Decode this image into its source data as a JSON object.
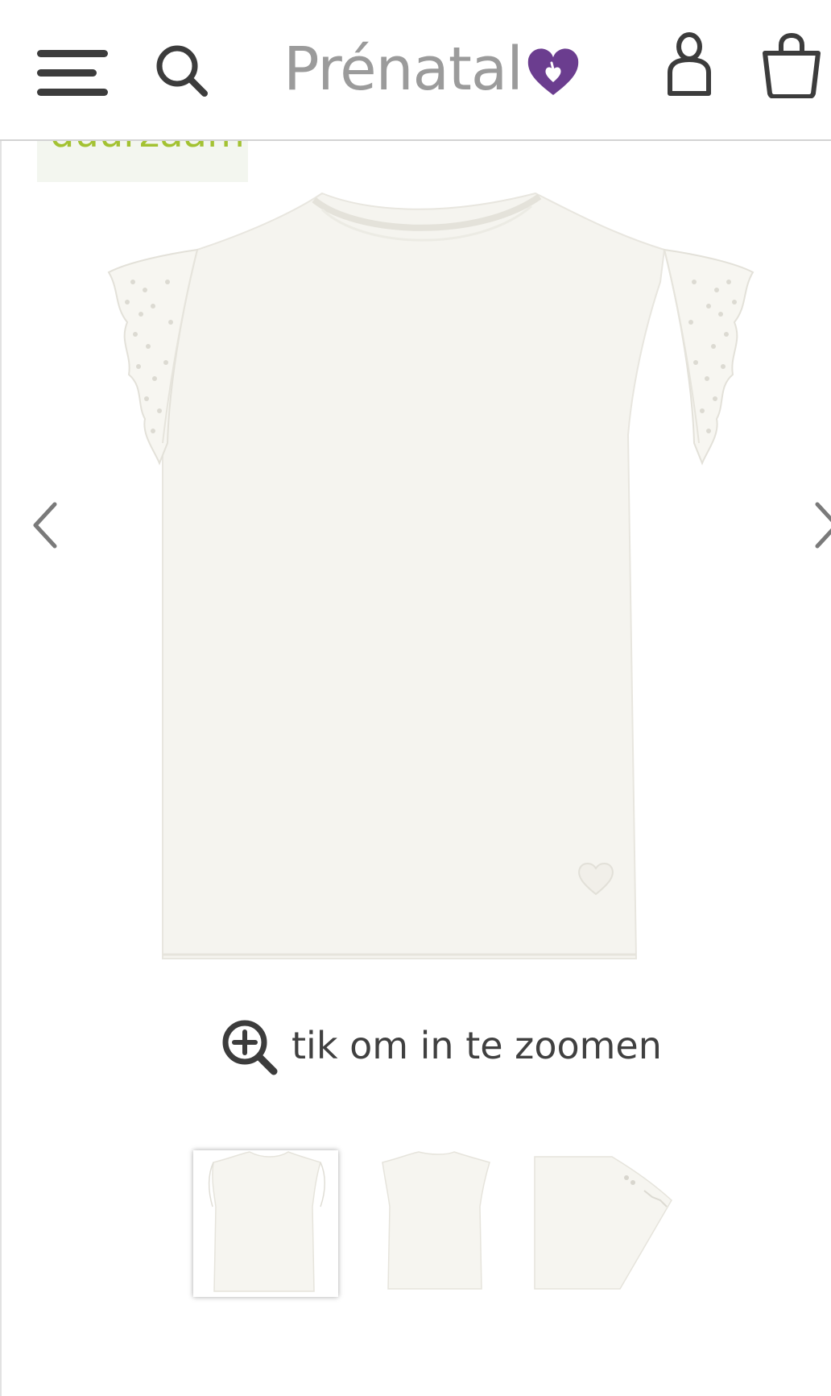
{
  "header": {
    "logo_text": "Prénatal",
    "icons": {
      "menu": "menu-icon",
      "search": "search-icon",
      "account": "user-icon",
      "cart": "shopping-bag-icon",
      "logo_heart": "heart-icon"
    }
  },
  "badge": {
    "label": "duurzaam"
  },
  "product": {
    "image_alt_icons": {
      "prev": "chevron-left-icon",
      "next": "chevron-right-icon"
    }
  },
  "zoom": {
    "label": "tik om in te zoomen",
    "icon": "zoom-in-icon"
  },
  "thumbnails": {
    "count": 3,
    "selected_index": 0
  },
  "colors": {
    "brand_purple": "#6b3d8f",
    "logo_gray": "#9b9b9b",
    "badge_green": "#a3c232",
    "badge_bg": "#f3f6ef",
    "icon_dark": "#3c3c3c"
  }
}
